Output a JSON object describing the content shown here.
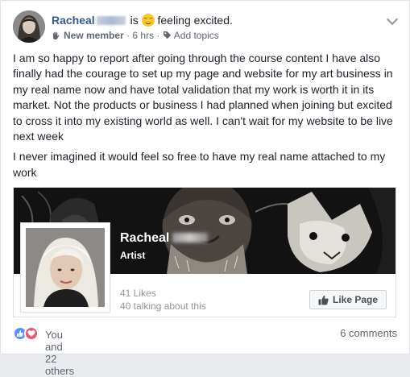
{
  "post": {
    "author": "Racheal",
    "activity": "is",
    "feeling_text": "feeling excited.",
    "badge": "New member",
    "time": "6 hrs",
    "add_topics": "Add topics",
    "paragraphs": [
      "I am so happy to report after going through the course content I have also finally had the courage to set up my page and website for my art business in my real name now and have total validation that my work is worth it in its market. Not the products or business I had planned when joining but excited to cross it into my existing world as well. I can't wait for my website to be live next week",
      "I never imagined it would feel so free to have my real name attached to my work"
    ]
  },
  "page_preview": {
    "name": "Racheal",
    "category": "Artist",
    "likes": "41 Likes",
    "talking": "40 talking about this",
    "like_button": "Like Page"
  },
  "footer": {
    "reactions_text": "You and 22 others",
    "comments": "6 comments"
  },
  "icons": {
    "reaction_like": "thumbs-up-icon",
    "reaction_love": "heart-icon",
    "feeling": "smiling-face-icon"
  },
  "colors": {
    "link_blue": "#365899",
    "meta_gray": "#606770",
    "like_blue": "#5890ff",
    "love_red": "#f25268"
  }
}
